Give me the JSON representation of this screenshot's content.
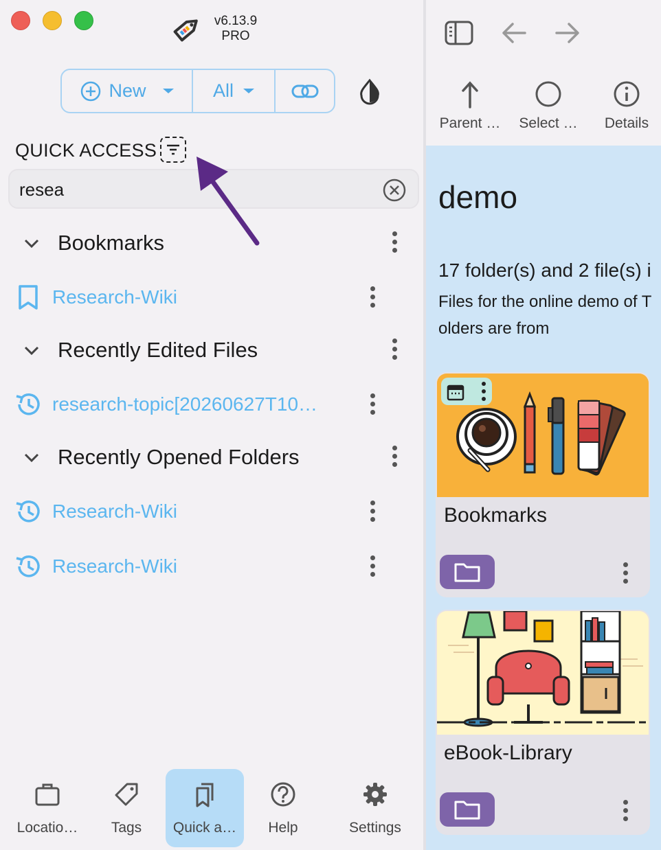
{
  "app": {
    "version": "v6.13.9",
    "edition": "PRO"
  },
  "toolbar": {
    "new_label": "New",
    "all_label": "All"
  },
  "quick_access": {
    "title": "QUICK ACCESS",
    "search_value": "resea",
    "sections": [
      {
        "label": "Bookmarks",
        "items": [
          {
            "label": "Research-Wiki",
            "icon": "bookmark-icon"
          }
        ]
      },
      {
        "label": "Recently Edited Files",
        "items": [
          {
            "label": "research-topic[20260627T10…",
            "icon": "history-icon"
          }
        ]
      },
      {
        "label": "Recently Opened Folders",
        "items": [
          {
            "label": "Research-Wiki",
            "icon": "history-icon"
          },
          {
            "label": "Research-Wiki",
            "icon": "history-icon"
          }
        ]
      }
    ]
  },
  "bottom_nav": [
    {
      "label": "Locatio…",
      "icon": "briefcase-icon"
    },
    {
      "label": "Tags",
      "icon": "tag-icon"
    },
    {
      "label": "Quick a…",
      "icon": "bookmarks-icon",
      "active": true
    },
    {
      "label": "Help",
      "icon": "help-icon"
    },
    {
      "label": "Settings",
      "icon": "gear-icon"
    }
  ],
  "right_panel": {
    "actions": [
      {
        "label": "Parent …",
        "icon": "arrow-up-icon"
      },
      {
        "label": "Select …",
        "icon": "circle-icon"
      },
      {
        "label": "Details",
        "icon": "info-icon"
      }
    ],
    "folder_title": "demo",
    "folder_stats": "17 folder(s) and 2 file(s) i",
    "folder_desc_line1": "Files for the online demo of T",
    "folder_desc_line2": "olders are from",
    "cards": [
      {
        "name": "Bookmarks",
        "type_icon": "folder-icon"
      },
      {
        "name": "eBook-Library",
        "type_icon": "folder-icon"
      }
    ]
  },
  "colors": {
    "accent": "#4fa9e6",
    "link": "#5bb6ef",
    "folder_badge": "#7e64a9",
    "content_bg": "#cfe5f7",
    "arrow": "#5b2a86"
  }
}
